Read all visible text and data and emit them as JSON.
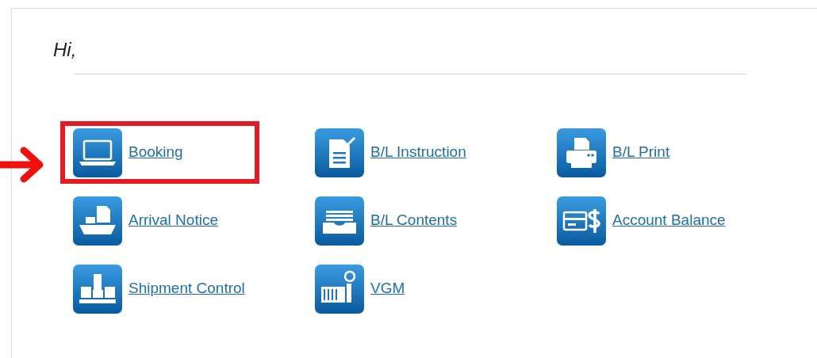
{
  "greeting": "Hi,",
  "menu_items": [
    {
      "label": "Booking",
      "highlighted": true
    },
    {
      "label": "B/L Instruction",
      "highlighted": false
    },
    {
      "label": "B/L Print",
      "highlighted": false
    },
    {
      "label": "Arrival Notice",
      "highlighted": false
    },
    {
      "label": "B/L Contents",
      "highlighted": false
    },
    {
      "label": "Account Balance",
      "highlighted": false
    },
    {
      "label": "Shipment Control",
      "highlighted": false
    },
    {
      "label": "VGM",
      "highlighted": false
    }
  ]
}
